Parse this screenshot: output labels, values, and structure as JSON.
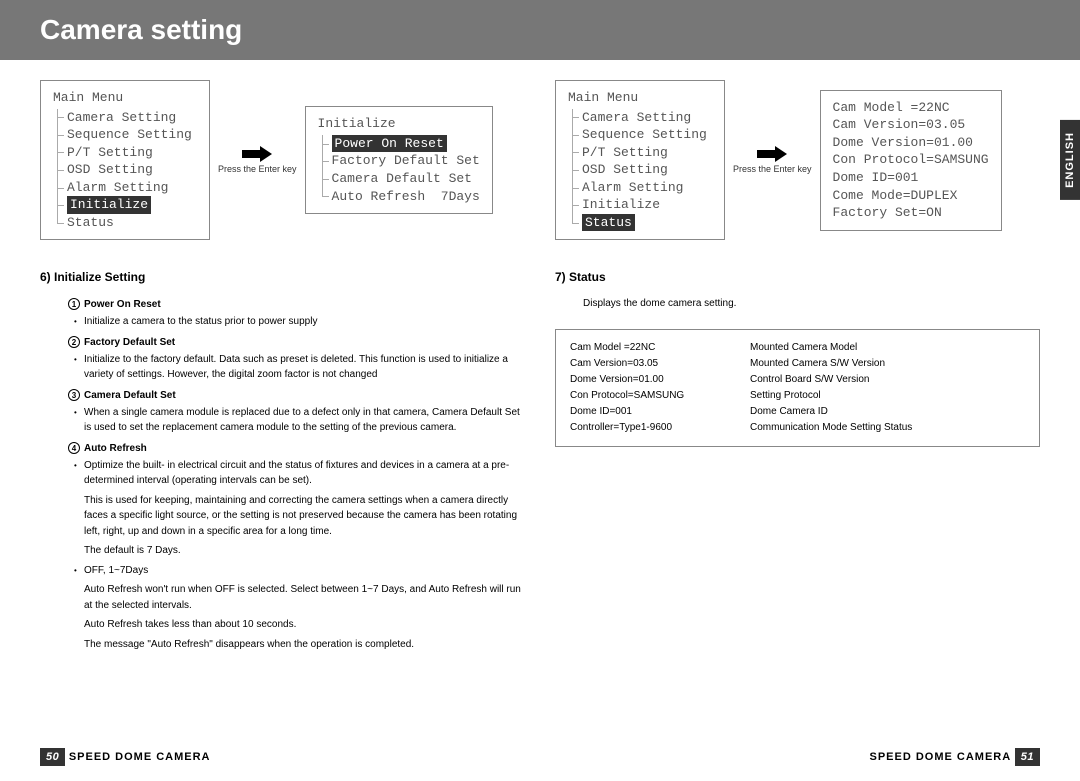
{
  "header": {
    "title": "Camera setting"
  },
  "langtab": "ENGLISH",
  "arrow_caption": "Press the Enter key",
  "left": {
    "menu1": {
      "title": "Main Menu",
      "items": [
        "Camera Setting",
        "Sequence Setting",
        "P/T Setting",
        "OSD Setting",
        "Alarm Setting",
        "Initialize",
        "Status"
      ],
      "selected": "Initialize"
    },
    "menu2": {
      "title": "Initialize",
      "items": [
        "Power On Reset",
        "Factory Default Set",
        "Camera Default Set"
      ],
      "last_label": "Auto Refresh",
      "last_value": "7Days",
      "selected": "Power On Reset"
    },
    "section": {
      "t": "6) Initialize Setting",
      "p1": {
        "t": "Power On Reset",
        "d": "Initialize a camera to the status prior to power supply"
      },
      "p2": {
        "t": "Factory Default Set",
        "d": "Initialize to the factory default. Data such as preset is deleted. This function is used to initialize a variety of settings. However, the digital zoom factor is not changed"
      },
      "p3": {
        "t": "Camera Default Set",
        "d": "When a single camera module is replaced due to a defect only in that camera, Camera Default Set is used to set the replacement camera module to the setting of the previous camera."
      },
      "p4": {
        "t": "Auto Refresh",
        "d1": "Optimize the built- in electrical circuit and the status of fixtures and devices in a camera at a pre-determined interval (operating intervals can be set).",
        "d2": "This is used for keeping, maintaining and correcting the camera settings when a camera directly faces a specific light source, or the setting is not preserved because the camera has been rotating left, right, up and down in a specific area for a long time.",
        "d3": "The default is 7 Days.",
        "d4": "OFF, 1~7Days",
        "d5": "Auto Refresh won't run when OFF is selected. Select between 1~7 Days, and Auto Refresh will run at the selected intervals.",
        "d6": "Auto Refresh takes less than about 10 seconds.",
        "d7": "The message \"Auto Refresh\" disappears when the operation is completed."
      }
    }
  },
  "right": {
    "menu1": {
      "title": "Main Menu",
      "items": [
        "Camera Setting",
        "Sequence Setting",
        "P/T Setting",
        "OSD Setting",
        "Alarm Setting",
        "Initialize",
        "Status"
      ],
      "selected": "Status"
    },
    "menu2": {
      "lines": [
        "Cam Model =22NC",
        "Cam Version=03.05",
        "Dome Version=01.00",
        "Con Protocol=SAMSUNG",
        "Dome ID=001",
        "Come Mode=DUPLEX",
        "Factory Set=ON"
      ]
    },
    "section": {
      "t": "7) Status",
      "d": "Displays the dome camera setting.",
      "rows": [
        [
          "Cam Model =22NC",
          "Mounted Camera Model"
        ],
        [
          "Cam Version=03.05",
          "Mounted Camera S/W Version"
        ],
        [
          "Dome Version=01.00",
          "Control Board S/W Version"
        ],
        [
          "Con Protocol=SAMSUNG",
          "Setting Protocol"
        ],
        [
          "Dome ID=001",
          "Dome Camera ID"
        ],
        [
          "Controller=Type1-9600",
          "Communication Mode Setting Status"
        ]
      ]
    }
  },
  "footer": {
    "left_page": "50",
    "right_page": "51",
    "product": "SPEED DOME CAMERA"
  }
}
